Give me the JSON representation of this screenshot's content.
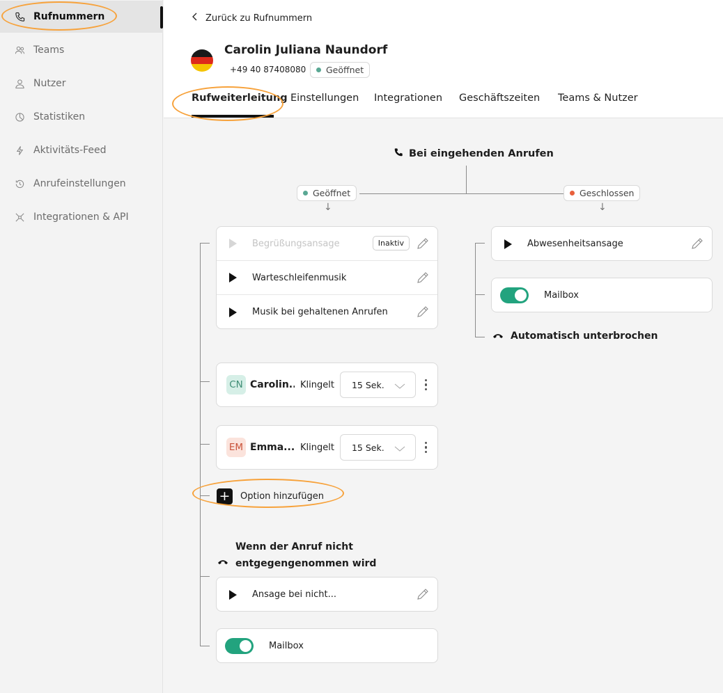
{
  "sidebar": {
    "items": [
      {
        "label": "Rufnummern",
        "icon": "phone-icon"
      },
      {
        "label": "Teams",
        "icon": "teams-icon"
      },
      {
        "label": "Nutzer",
        "icon": "user-icon"
      },
      {
        "label": "Statistiken",
        "icon": "pie-chart-icon"
      },
      {
        "label": "Aktivitäts-Feed",
        "icon": "bolt-icon"
      },
      {
        "label": "Anrufeinstellungen",
        "icon": "history-icon"
      },
      {
        "label": "Integrationen & API",
        "icon": "integration-icon"
      }
    ]
  },
  "header": {
    "back_label": "Zurück zu Rufnummern",
    "name": "Carolin Juliana Naundorf",
    "number": "+49 40 87408080",
    "status": "Geöffnet",
    "tabs": [
      "Rufweiterleitung",
      "Einstellungen",
      "Integrationen",
      "Geschäftszeiten",
      "Teams & Nutzer"
    ]
  },
  "flow": {
    "title": "Bei eingehenden Anrufen",
    "open_label": "Geöffnet",
    "closed_label": "Geschlossen",
    "open_rows": [
      {
        "label": "Begrüßungsansage",
        "badge": "Inaktiv"
      },
      {
        "label": "Warteschleifenmusik"
      },
      {
        "label": "Musik bei gehaltenen Anrufen"
      }
    ],
    "members": [
      {
        "initials": "CN",
        "name": "Carolin...",
        "ring_label": "Klingelt",
        "duration": "15 Sek."
      },
      {
        "initials": "EM",
        "name": "Emma...",
        "ring_label": "Klingelt",
        "duration": "15 Sek."
      }
    ],
    "add_option": "Option hinzufügen",
    "no_answer_title": "Wenn der Anruf nicht entgegengenommen wird",
    "no_answer_line1": "Wenn der Anruf nicht",
    "no_answer_line2": "entgegengenommen wird",
    "no_answer_row": "Ansage bei nicht...",
    "no_answer_mailbox": "Mailbox",
    "closed_row": "Abwesenheitsansage",
    "closed_mailbox": "Mailbox",
    "closed_end": "Automatisch unterbrochen"
  },
  "colors": {
    "accent_green": "#22a37e",
    "open_dot": "#5aa894",
    "closed_dot": "#e8603c",
    "highlight": "#f7a23b"
  }
}
